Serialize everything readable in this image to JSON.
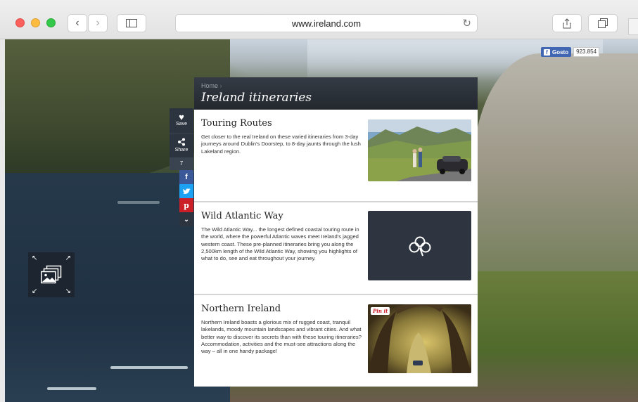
{
  "browser": {
    "url": "www.ireland.com"
  },
  "facebook": {
    "label": "Gosto",
    "count": "923.854"
  },
  "share_bar": {
    "save_label": "Save",
    "share_label": "Share",
    "share_count": "7",
    "colors": {
      "facebook": "#3b5998",
      "twitter": "#1da1f2",
      "pinterest": "#cb2027"
    }
  },
  "panel": {
    "breadcrumb": "Home",
    "title": "Ireland itineraries",
    "cards": [
      {
        "title": "Touring Routes",
        "text": "Get closer to the real Ireland on these varied itineraries from 3-day journeys around Dublin's Doorstep, to 8-day jaunts through the lush Lakeland region."
      },
      {
        "title": "Wild Atlantic Way",
        "text": "The Wild Atlantic Way... the longest defined coastal touring route in the world, where the powerful Atlantic waves meet Ireland's jagged western coast. These pre-planned itineraries bring you along the 2,500km length of the Wild Atlantic Way, showing you highlights of what to do, see and eat throughout your journey."
      },
      {
        "title": "Northern Ireland",
        "text": "Northern Ireland boasts a glorious mix of rugged coast, tranquil lakelands, moody mountain landscapes and vibrant cities. And what better way to discover its secrets than with these touring itineraries? Accommodation, activities and the must-see attractions along the way – all in one handy package!",
        "pin_label": "Pin it"
      }
    ]
  }
}
